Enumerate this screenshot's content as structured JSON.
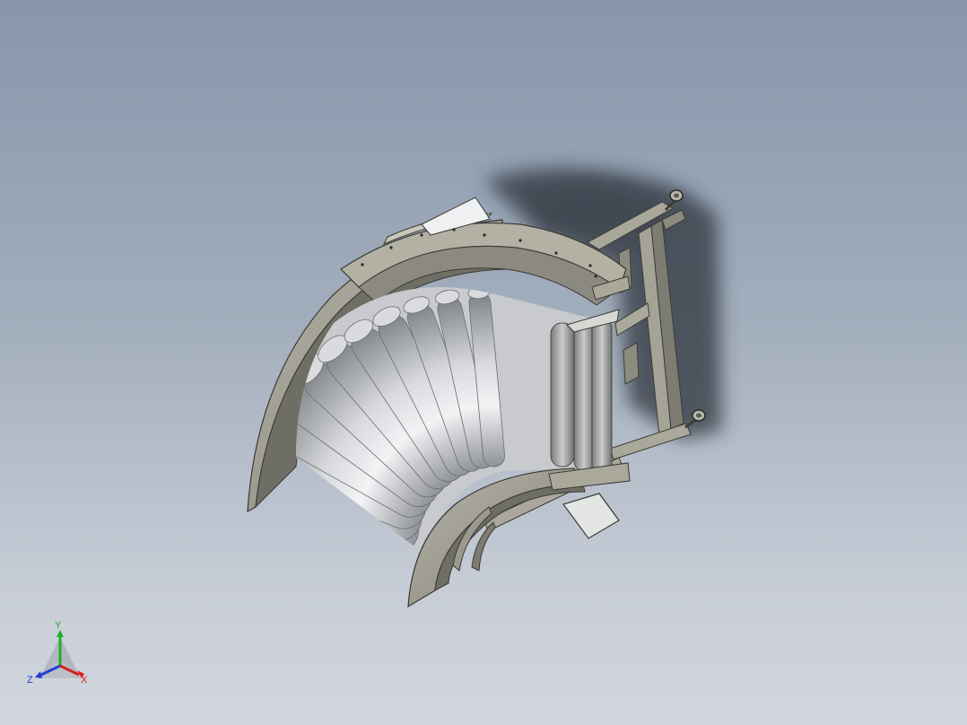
{
  "viewport": {
    "background_top": "#8796ab",
    "background_bottom": "#d2d6de"
  },
  "model": {
    "name_icon": "curved-roller-conveyor-icon",
    "roller_count": 12,
    "colors": {
      "frame": "#9c9b8e",
      "frame_dark": "#5e5d55",
      "roller_light": "#eceef0",
      "roller_dark": "#8f9296",
      "guard": "#a7a598",
      "guard_dark": "#6c6b62",
      "shadow": "#2e343c"
    }
  },
  "triad": {
    "x_label": "X",
    "y_label": "Y",
    "z_label": "Z",
    "x_color": "#d62020",
    "y_color": "#1fae2a",
    "z_color": "#1f3fd6"
  }
}
